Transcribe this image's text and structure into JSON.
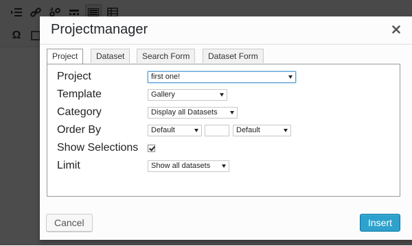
{
  "toolbar": {
    "row1_icons": [
      "indent-icon",
      "link-icon",
      "unlink-icon",
      "horizontal-line-icon",
      "keyboard-icon",
      "table-icon"
    ],
    "row2_icons": [
      "omega-icon",
      "special-icon"
    ]
  },
  "dialog": {
    "title": "Projectmanager",
    "close_symbol": "✕",
    "tabs": [
      {
        "label": "Project",
        "active": true
      },
      {
        "label": "Dataset",
        "active": false
      },
      {
        "label": "Search Form",
        "active": false
      },
      {
        "label": "Dataset Form",
        "active": false
      }
    ],
    "fields": {
      "project": {
        "label": "Project",
        "value": "first one!"
      },
      "template": {
        "label": "Template",
        "value": "Gallery"
      },
      "category": {
        "label": "Category",
        "value": "Display all Datasets"
      },
      "order_by": {
        "label": "Order By",
        "field_value": "Default",
        "text_value": "",
        "direction_value": "Default"
      },
      "show_selections": {
        "label": "Show Selections",
        "checked": true
      },
      "limit": {
        "label": "Limit",
        "value": "Show all datasets"
      }
    },
    "buttons": {
      "cancel": "Cancel",
      "insert": "Insert"
    }
  }
}
